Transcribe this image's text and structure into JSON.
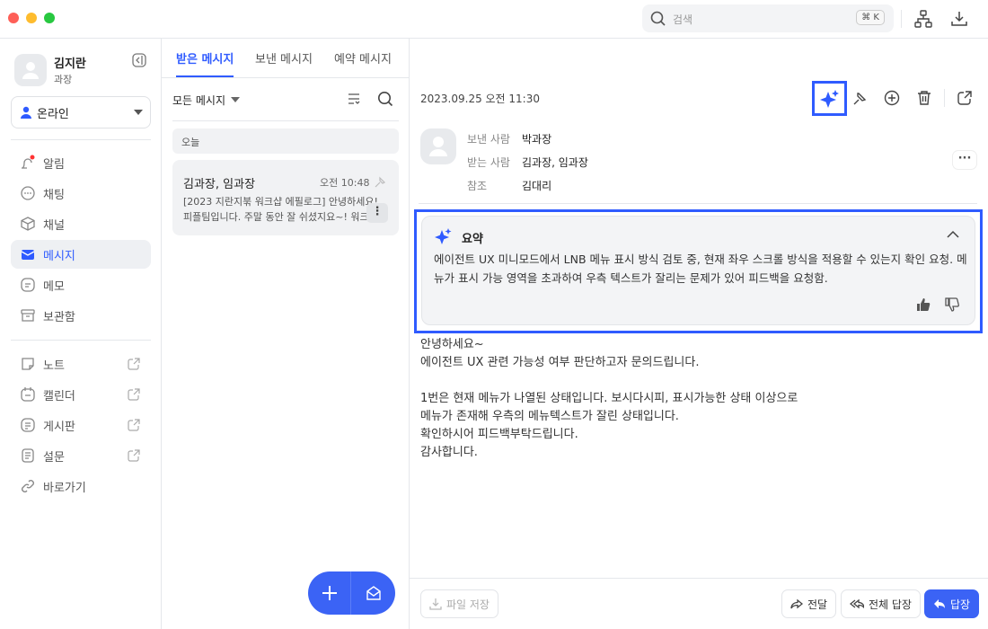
{
  "titlebar": {
    "search_placeholder": "검색",
    "shortcut": "⌘ K"
  },
  "profile": {
    "name": "김지란",
    "title": "과장",
    "status": "온라인"
  },
  "sidebar": {
    "items": [
      {
        "label": "알림",
        "icon": "bell-icon",
        "badge": true
      },
      {
        "label": "채팅",
        "icon": "chat-icon"
      },
      {
        "label": "채널",
        "icon": "cube-icon"
      },
      {
        "label": "메시지",
        "icon": "mail-icon",
        "active": true
      },
      {
        "label": "메모",
        "icon": "memo-icon"
      },
      {
        "label": "보관함",
        "icon": "archive-icon"
      }
    ],
    "apps": [
      {
        "label": "노트",
        "icon": "note-icon"
      },
      {
        "label": "캘린더",
        "icon": "calendar-icon"
      },
      {
        "label": "게시판",
        "icon": "board-icon"
      },
      {
        "label": "설문",
        "icon": "survey-icon"
      },
      {
        "label": "바로가기",
        "icon": "link-icon"
      }
    ]
  },
  "tabs": [
    {
      "label": "받은 메시지",
      "active": true
    },
    {
      "label": "보낸 메시지"
    },
    {
      "label": "예약 메시지"
    }
  ],
  "list": {
    "filter": "모든 메시지",
    "group": "오늘",
    "items": [
      {
        "sender": "김과장, 임과장",
        "time": "오전 10:48",
        "preview1": "[2023 지란지붂 워크샵 에필로그] 안녕하세요!",
        "preview2": "피플팀입니다. 주말 동안 잘 쉬셨지요~! 워크"
      }
    ]
  },
  "message": {
    "datetime": "2023.09.25 오전 11:30",
    "from_label": "보낸 사람",
    "from": "박과장",
    "to_label": "받는 사람",
    "to": "김과장, 임과장",
    "cc_label": "참조",
    "cc": "김대리",
    "summary": {
      "title": "요약",
      "text": "에이전트 UX 미니모드에서 LNB 메뉴 표시 방식 검토 중, 현재 좌우 스크롤 방식을 적용할 수 있는지 확인 요청. 메뉴가 표시 가능 영역을 초과하여 우측 텍스트가 잘리는 문제가 있어 피드백을 요청함."
    },
    "body": [
      "안녕하세요~",
      "에이전트 UX 관련 가능성 여부 판단하고자 문의드립니다.",
      "",
      "1번은 현재 메뉴가 나열된 상태입니다. 보시다시피, 표시가능한 상태 이상으로",
      "메뉴가 존재해 우측의 메뉴텍스트가 잘린 상태입니다.",
      "확인하시어 피드백부탁드립니다.",
      "감사합니다."
    ]
  },
  "footer": {
    "save": "파일 저장",
    "forward": "전달",
    "reply_all": "전체 답장",
    "reply": "답장"
  },
  "colors": {
    "accent": "#2f5bff",
    "highlight": "#2f5bff"
  }
}
